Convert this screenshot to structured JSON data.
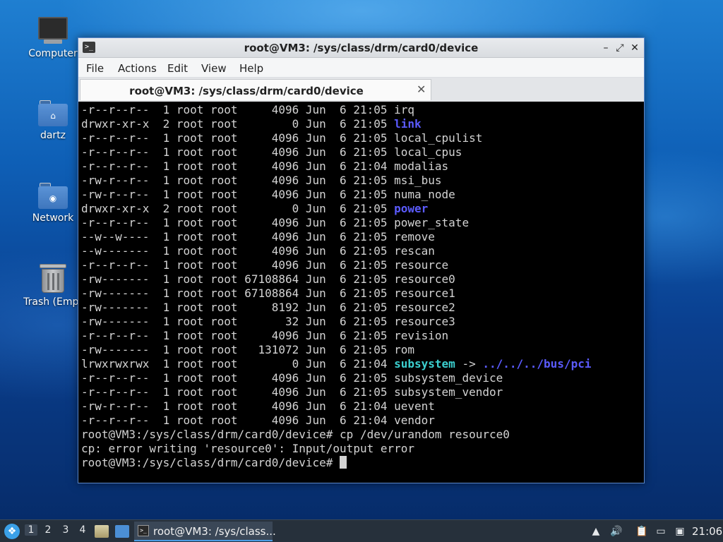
{
  "desktop": {
    "icons": [
      {
        "label": "Computer",
        "icon": "computer-icon"
      },
      {
        "label": "dartz",
        "icon": "home-folder-icon"
      },
      {
        "label": "Network",
        "icon": "network-folder-icon"
      },
      {
        "label": "Trash (Empt",
        "icon": "trash-icon"
      }
    ]
  },
  "window": {
    "title": "root@VM3: /sys/class/drm/card0/device",
    "menu": [
      "File",
      "Actions",
      "Edit",
      "View",
      "Help"
    ],
    "tab_title": "root@VM3: /sys/class/drm/card0/device",
    "close_glyph": "✕",
    "minimize_glyph": "–",
    "maximize_glyph": "⤢",
    "tab_close_glyph": "✕",
    "app_icon_glyph": ">_"
  },
  "terminal": {
    "colors": {
      "dir": "#5b5bff",
      "link": "#3cd0d0",
      "text": "#d3d3d3"
    },
    "listing": [
      {
        "meta": "-r--r--r--  1 root root     4096 Jun  6 21:05 ",
        "name": "irq",
        "type": "file"
      },
      {
        "meta": "drwxr-xr-x  2 root root        0 Jun  6 21:05 ",
        "name": "link",
        "type": "dir"
      },
      {
        "meta": "-r--r--r--  1 root root     4096 Jun  6 21:05 ",
        "name": "local_cpulist",
        "type": "file"
      },
      {
        "meta": "-r--r--r--  1 root root     4096 Jun  6 21:05 ",
        "name": "local_cpus",
        "type": "file"
      },
      {
        "meta": "-r--r--r--  1 root root     4096 Jun  6 21:04 ",
        "name": "modalias",
        "type": "file"
      },
      {
        "meta": "-rw-r--r--  1 root root     4096 Jun  6 21:05 ",
        "name": "msi_bus",
        "type": "file"
      },
      {
        "meta": "-rw-r--r--  1 root root     4096 Jun  6 21:05 ",
        "name": "numa_node",
        "type": "file"
      },
      {
        "meta": "drwxr-xr-x  2 root root        0 Jun  6 21:05 ",
        "name": "power",
        "type": "dir"
      },
      {
        "meta": "-r--r--r--  1 root root     4096 Jun  6 21:05 ",
        "name": "power_state",
        "type": "file"
      },
      {
        "meta": "--w--w----  1 root root     4096 Jun  6 21:05 ",
        "name": "remove",
        "type": "file"
      },
      {
        "meta": "--w-------  1 root root     4096 Jun  6 21:05 ",
        "name": "rescan",
        "type": "file"
      },
      {
        "meta": "-r--r--r--  1 root root     4096 Jun  6 21:05 ",
        "name": "resource",
        "type": "file"
      },
      {
        "meta": "-rw-------  1 root root 67108864 Jun  6 21:05 ",
        "name": "resource0",
        "type": "file"
      },
      {
        "meta": "-rw-------  1 root root 67108864 Jun  6 21:05 ",
        "name": "resource1",
        "type": "file"
      },
      {
        "meta": "-rw-------  1 root root     8192 Jun  6 21:05 ",
        "name": "resource2",
        "type": "file"
      },
      {
        "meta": "-rw-------  1 root root       32 Jun  6 21:05 ",
        "name": "resource3",
        "type": "file"
      },
      {
        "meta": "-r--r--r--  1 root root     4096 Jun  6 21:05 ",
        "name": "revision",
        "type": "file"
      },
      {
        "meta": "-rw-------  1 root root   131072 Jun  6 21:05 ",
        "name": "rom",
        "type": "file"
      },
      {
        "meta": "lrwxrwxrwx  1 root root        0 Jun  6 21:04 ",
        "name": "subsystem",
        "type": "link",
        "arrow": " -> ",
        "target": "../../../bus/pci"
      },
      {
        "meta": "-r--r--r--  1 root root     4096 Jun  6 21:05 ",
        "name": "subsystem_device",
        "type": "file"
      },
      {
        "meta": "-r--r--r--  1 root root     4096 Jun  6 21:05 ",
        "name": "subsystem_vendor",
        "type": "file"
      },
      {
        "meta": "-rw-r--r--  1 root root     4096 Jun  6 21:04 ",
        "name": "uevent",
        "type": "file"
      },
      {
        "meta": "-r--r--r--  1 root root     4096 Jun  6 21:04 ",
        "name": "vendor",
        "type": "file"
      }
    ],
    "command_line": "root@VM3:/sys/class/drm/card0/device# cp /dev/urandom resource0",
    "error_line": "cp: error writing 'resource0': Input/output error",
    "prompt": "root@VM3:/sys/class/drm/card0/device# "
  },
  "taskbar": {
    "workspaces": [
      "1",
      "2",
      "3",
      "4"
    ],
    "active_workspace": "1",
    "task_label": "root@VM3: /sys/class...",
    "clock": "21:06"
  }
}
